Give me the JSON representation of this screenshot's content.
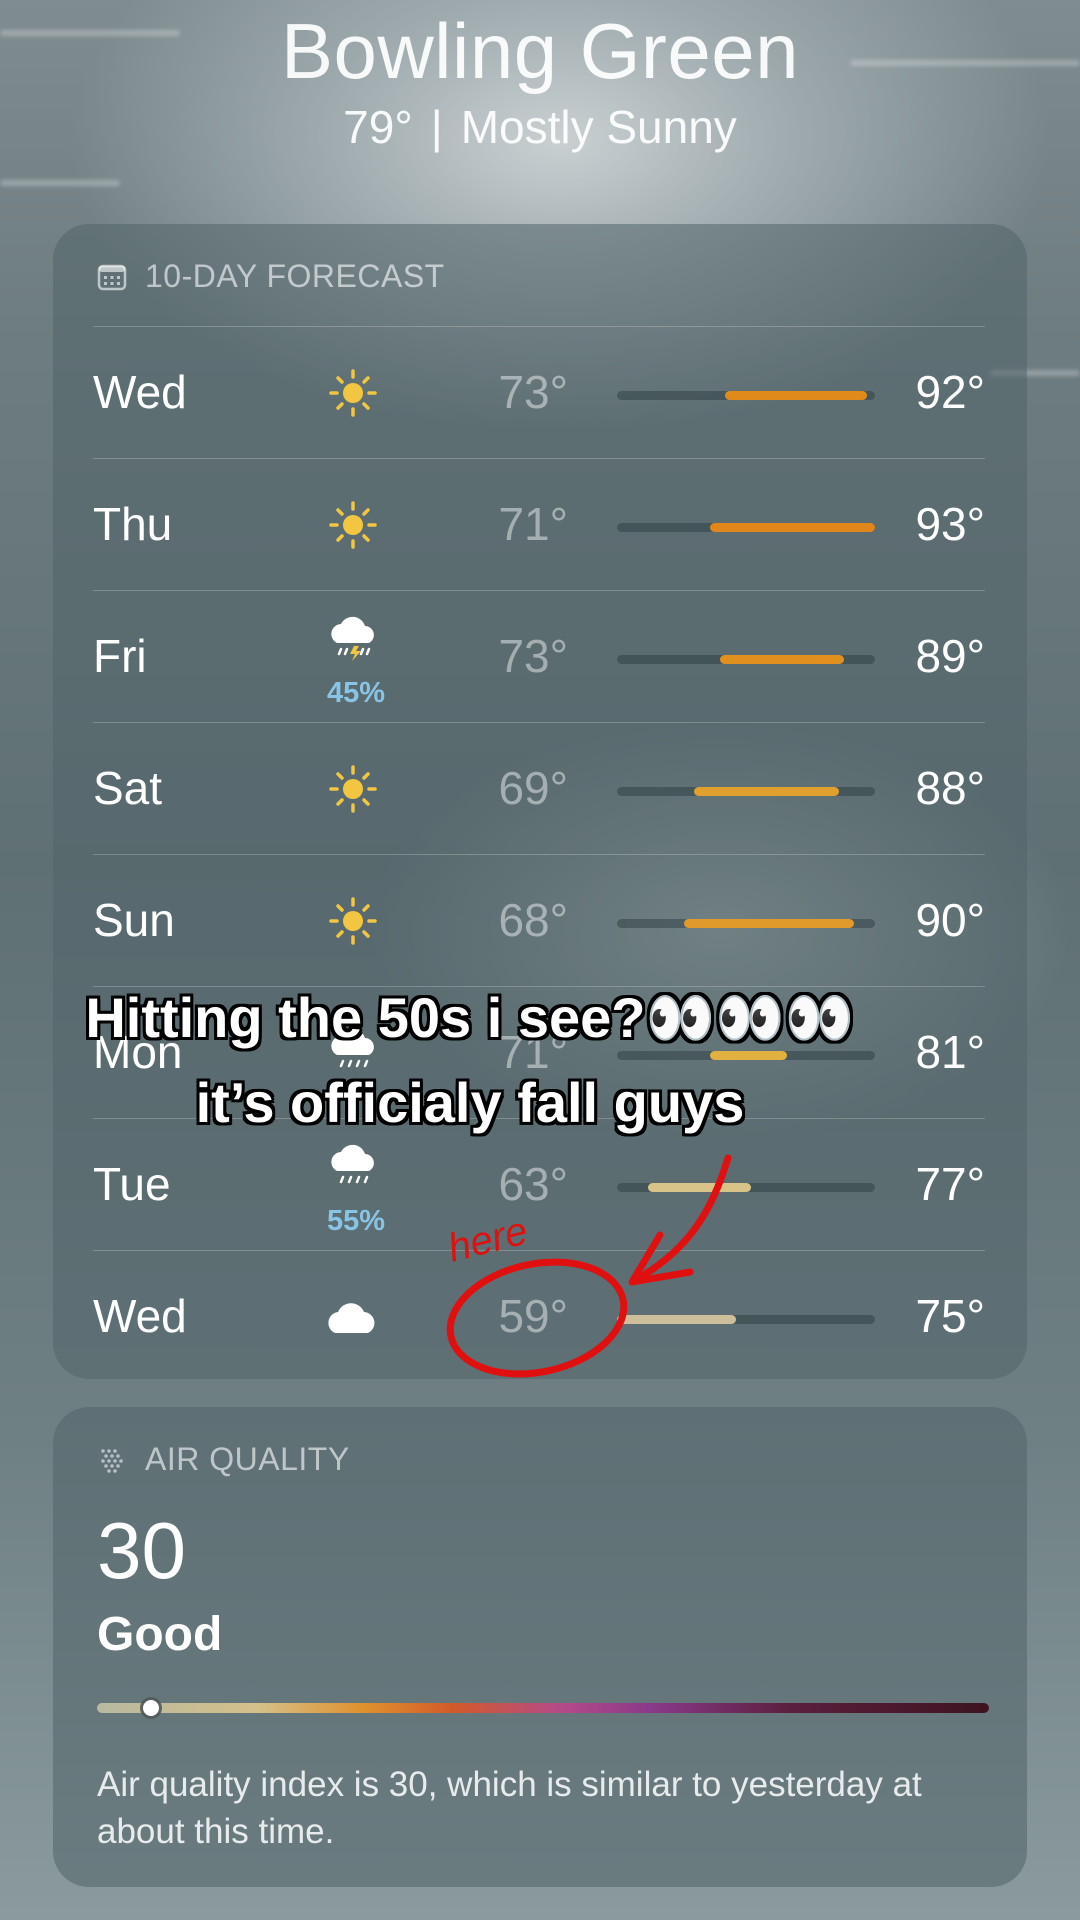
{
  "location": {
    "city": "Bowling Green",
    "temp": "79°",
    "separator": "|",
    "condition": "Mostly Sunny"
  },
  "forecast": {
    "header": "10-DAY FORECAST",
    "header_icon": "calendar-icon",
    "rows": [
      {
        "day": "Wed",
        "icon": "sun-icon",
        "precip": "",
        "low": "73°",
        "high": "92°",
        "range_start": 0.42,
        "range_end": 0.97,
        "color": "#e08a1c"
      },
      {
        "day": "Thu",
        "icon": "sun-icon",
        "precip": "",
        "low": "71°",
        "high": "93°",
        "range_start": 0.36,
        "range_end": 1.0,
        "color": "#e0861a"
      },
      {
        "day": "Fri",
        "icon": "thunderstorm-icon",
        "precip": "45%",
        "low": "73°",
        "high": "89°",
        "range_start": 0.4,
        "range_end": 0.88,
        "color": "#e0901e"
      },
      {
        "day": "Sat",
        "icon": "sun-icon",
        "precip": "",
        "low": "69°",
        "high": "88°",
        "range_start": 0.3,
        "range_end": 0.86,
        "color": "#e0a030"
      },
      {
        "day": "Sun",
        "icon": "sun-icon",
        "precip": "",
        "low": "68°",
        "high": "90°",
        "range_start": 0.26,
        "range_end": 0.92,
        "color": "#e09a2c"
      },
      {
        "day": "Mon",
        "icon": "rain-icon",
        "precip": "",
        "low": "71°",
        "high": "81°",
        "range_start": 0.36,
        "range_end": 0.66,
        "color": "#e0b040"
      },
      {
        "day": "Tue",
        "icon": "rain-icon",
        "precip": "55%",
        "low": "63°",
        "high": "77°",
        "range_start": 0.12,
        "range_end": 0.52,
        "color": "#d8c488"
      },
      {
        "day": "Wed",
        "icon": "cloud-icon",
        "precip": "",
        "low": "59°",
        "high": "75°",
        "range_start": 0.0,
        "range_end": 0.46,
        "color": "#cdbf9c"
      }
    ]
  },
  "caption": {
    "line1": "Hitting the 50s i see?👀👀👀",
    "line2": "it’s officialy fall guys"
  },
  "annotation": {
    "text": "here",
    "color": "#e01010"
  },
  "air_quality": {
    "header": "AIR QUALITY",
    "header_icon": "air-quality-icon",
    "value": "30",
    "label": "Good",
    "level": 0.06,
    "description": "Air quality index is 30, which is similar to yesterday at about this time."
  }
}
